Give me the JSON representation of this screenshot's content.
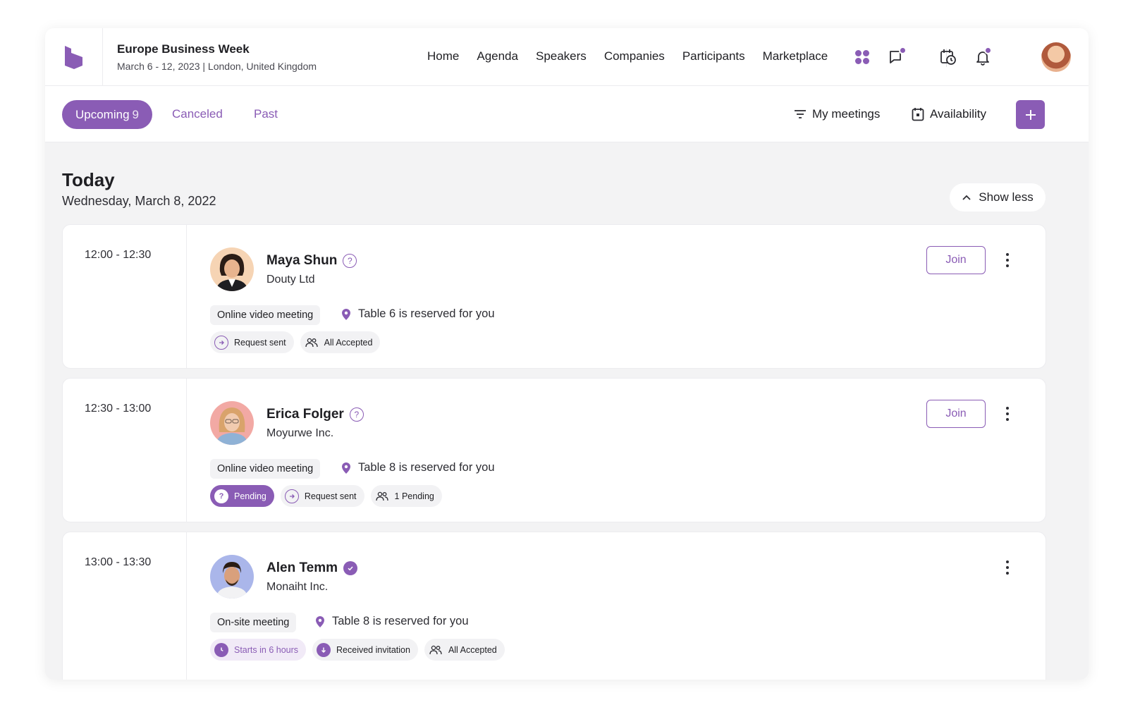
{
  "header": {
    "event_title": "Europe Business Week",
    "event_subtitle": "March 6 - 12, 2023 | London, United Kingdom",
    "nav": [
      "Home",
      "Agenda",
      "Speakers",
      "Companies",
      "Participants",
      "Marketplace"
    ]
  },
  "tabs": {
    "upcoming_label": "Upcoming",
    "upcoming_count": "9",
    "canceled": "Canceled",
    "past": "Past"
  },
  "actions": {
    "my_meetings": "My meetings",
    "availability": "Availability"
  },
  "today": {
    "title": "Today",
    "date": "Wednesday, March 8, 2022",
    "show_less": "Show less"
  },
  "meetings": [
    {
      "time": "12:00 - 12:30",
      "name": "Maya Shun",
      "company": "Douty Ltd",
      "verified": false,
      "meeting_type": "Online video meeting",
      "table": "Table 6 is reserved for you",
      "join": "Join",
      "chips": [
        "Request sent",
        "All Accepted"
      ]
    },
    {
      "time": "12:30 - 13:00",
      "name": "Erica Folger",
      "company": "Moyurwe Inc.",
      "verified": false,
      "meeting_type": "Online video meeting",
      "table": "Table 8 is reserved for you",
      "join": "Join",
      "chips": [
        "Pending",
        "Request sent",
        "1 Pending"
      ]
    },
    {
      "time": "13:00 - 13:30",
      "name": "Alen Temm",
      "company": "Monaiht Inc.",
      "verified": true,
      "meeting_type": "On-site meeting",
      "table": "Table 8 is reserved for you",
      "chips": [
        "Starts in 6 hours",
        "Received invitation",
        "All Accepted"
      ]
    }
  ],
  "colors": {
    "accent": "#8a5cb5",
    "accent_light": "#f1eaf7",
    "chip_bg": "#f2f2f4"
  }
}
